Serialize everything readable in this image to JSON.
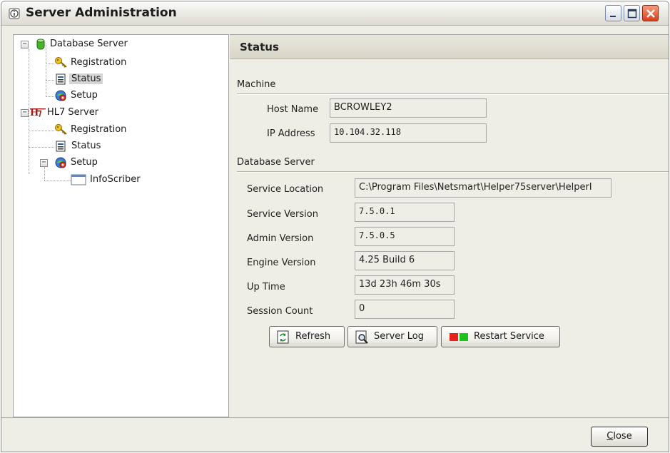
{
  "window": {
    "title": "Server Administration"
  },
  "tree": {
    "database_server": "Database Server",
    "db_registration": "Registration",
    "db_status": "Status",
    "db_setup": "Setup",
    "hl7_server": "HL7 Server",
    "hl7_registration": "Registration",
    "hl7_status": "Status",
    "hl7_setup": "Setup",
    "infoscriber": "InfoScriber"
  },
  "panel": {
    "title": "Status",
    "machine_section": "Machine",
    "host_name_label": "Host Name",
    "host_name_value": "BCROWLEY2",
    "ip_address_label": "IP Address",
    "ip_address_value": "10.104.32.118",
    "db_section": "Database Server",
    "service_location_label": "Service Location",
    "service_location_value": "C:\\Program Files\\Netsmart\\Helper75server\\HelperI",
    "service_version_label": "Service Version",
    "service_version_value": "7.5.0.1",
    "admin_version_label": "Admin Version",
    "admin_version_value": "7.5.0.5",
    "engine_version_label": "Engine Version",
    "engine_version_value": "4.25 Build 6",
    "up_time_label": "Up Time",
    "up_time_value": "13d 23h 46m 30s",
    "session_count_label": "Session Count",
    "session_count_value": "0"
  },
  "buttons": {
    "refresh": "Refresh",
    "server_log": "Server Log",
    "restart_service": "Restart Service",
    "close_mnemonic": "C",
    "close_rest": "lose"
  },
  "colors": {
    "accent_red": "#e8221b",
    "accent_green": "#1fc21a",
    "selection_bg": "#d5d5d5"
  },
  "icons": {
    "app": "info-icon",
    "database": "database-icon",
    "registration": "key-icon",
    "status": "document-icon",
    "setup": "gear-globe-icon",
    "hl7": "hl7-icon",
    "infoscriber": "window-icon"
  }
}
